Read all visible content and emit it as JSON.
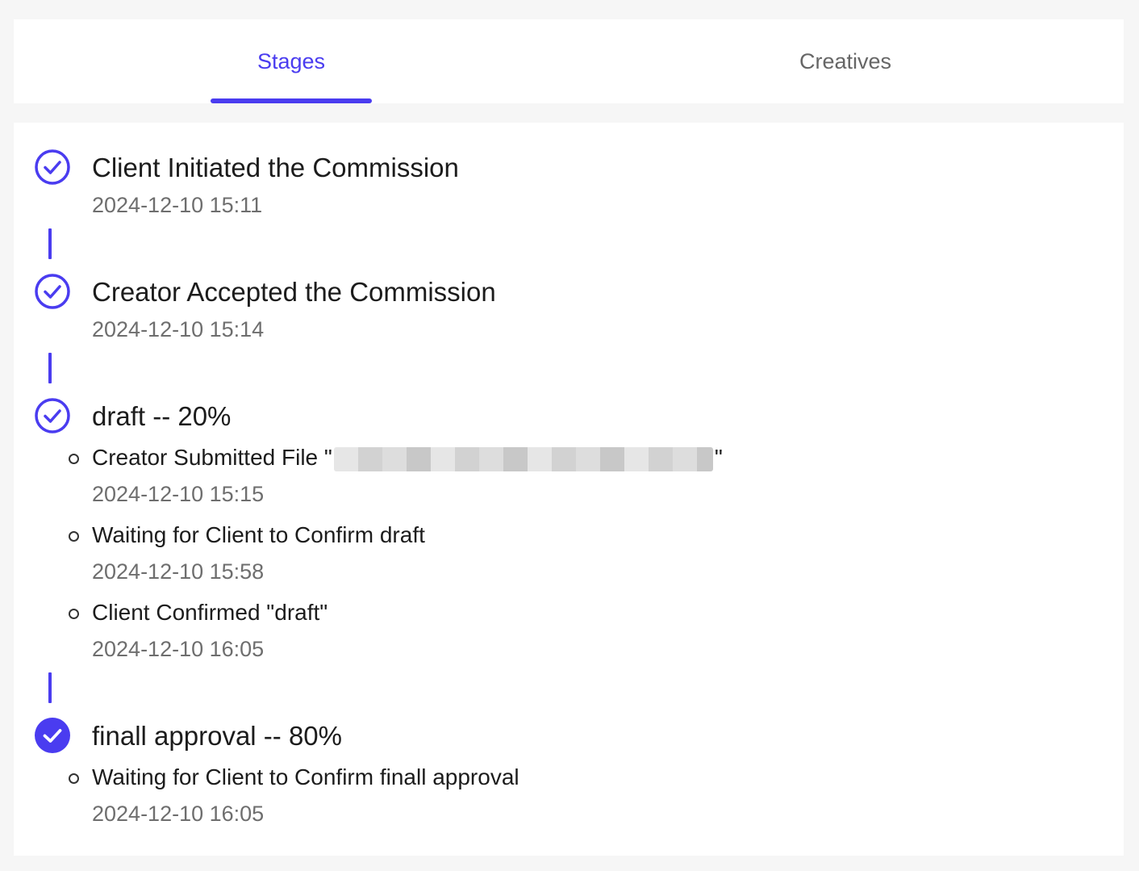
{
  "colors": {
    "accent": "#4a3cf0"
  },
  "tabs": [
    {
      "label": "Stages",
      "active": true
    },
    {
      "label": "Creatives",
      "active": false
    }
  ],
  "timeline": {
    "stages": [
      {
        "title": "Client Initiated the Commission",
        "timestamp": "2024-12-10 15:11",
        "icon": "check-circle-outline-icon"
      },
      {
        "title": "Creator Accepted the Commission",
        "timestamp": "2024-12-10 15:14",
        "icon": "check-circle-outline-icon"
      },
      {
        "title": "draft -- 20%",
        "icon": "check-circle-outline-icon",
        "events": [
          {
            "text_prefix": "Creator Submitted File \"",
            "text_suffix": "\"",
            "timestamp": "2024-12-10 15:15"
          },
          {
            "text": "Waiting for Client to Confirm draft",
            "timestamp": "2024-12-10 15:58"
          },
          {
            "text": "Client Confirmed \"draft\"",
            "timestamp": "2024-12-10 16:05"
          }
        ]
      },
      {
        "title": "finall approval -- 80%",
        "icon": "check-circle-filled-icon",
        "events": [
          {
            "text": "Waiting for Client to Confirm finall approval",
            "timestamp": "2024-12-10 16:05"
          }
        ]
      }
    ]
  }
}
